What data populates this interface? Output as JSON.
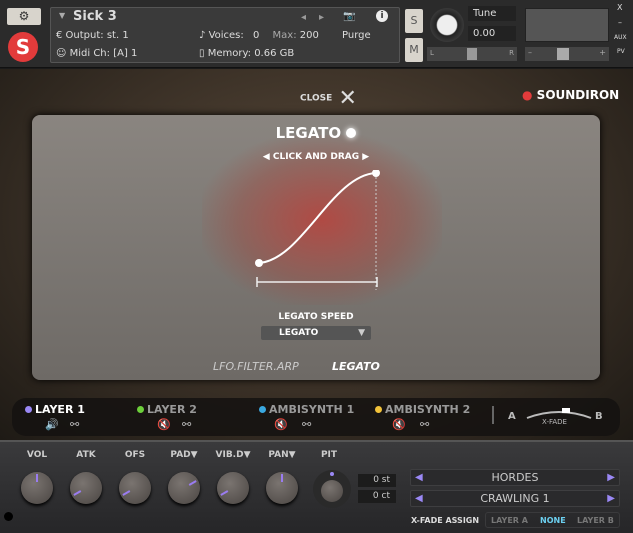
{
  "header": {
    "instrument_name": "Sick 3",
    "output_label": "Output:",
    "output_value": "st. 1",
    "midi_label": "Midi Ch:",
    "midi_value": "[A] 1",
    "voices_label": "Voices:",
    "voices_value": "0",
    "max_label": "Max:",
    "max_value": "200",
    "memory_label": "Memory:",
    "memory_value": "0.66 GB",
    "purge": "Purge",
    "solo": "S",
    "mute": "M",
    "tune_label": "Tune",
    "tune_value": "0.00",
    "pan_l": "L",
    "pan_r": "R",
    "aux": "AUX",
    "pv": "PV",
    "close_x": "X",
    "minimize": "–",
    "vol_minus": "–",
    "vol_plus": "+"
  },
  "brand": {
    "close_label": "CLOSE",
    "logo": "SOUNDIRON"
  },
  "panel": {
    "title": "LEGATO",
    "hint": "CLICK AND DRAG",
    "speed_label": "LEGATO SPEED",
    "speed_value": "LEGATO",
    "tabs": [
      "LFO.FILTER.ARP",
      "LEGATO"
    ]
  },
  "layers": [
    {
      "name": "LAYER 1",
      "color": "#9a88f5",
      "active": true
    },
    {
      "name": "LAYER 2",
      "color": "#6ccf3a"
    },
    {
      "name": "AMBISYNTH 1",
      "color": "#3aa8e0"
    },
    {
      "name": "AMBISYNTH 2",
      "color": "#f2c23a"
    }
  ],
  "xfade": {
    "a": "A",
    "b": "B",
    "label": "X-FADE"
  },
  "knobs": [
    {
      "label": "VOL",
      "angle": 0
    },
    {
      "label": "ATK",
      "angle": -120
    },
    {
      "label": "OFS",
      "angle": -120
    },
    {
      "label": "PAD▼",
      "angle": 60
    },
    {
      "label": "VIB.D▼",
      "angle": -120
    },
    {
      "label": "PAN▼",
      "angle": 0
    },
    {
      "label": "PIT",
      "angle": 0
    }
  ],
  "pitch": {
    "st": "0 st",
    "ct": "0 ct"
  },
  "selectors": [
    "HORDES",
    "CRAWLING 1"
  ],
  "xfade_assign": {
    "label": "X-FADE ASSIGN",
    "options": [
      "LAYER A",
      "NONE",
      "LAYER B"
    ],
    "selected": "NONE"
  }
}
